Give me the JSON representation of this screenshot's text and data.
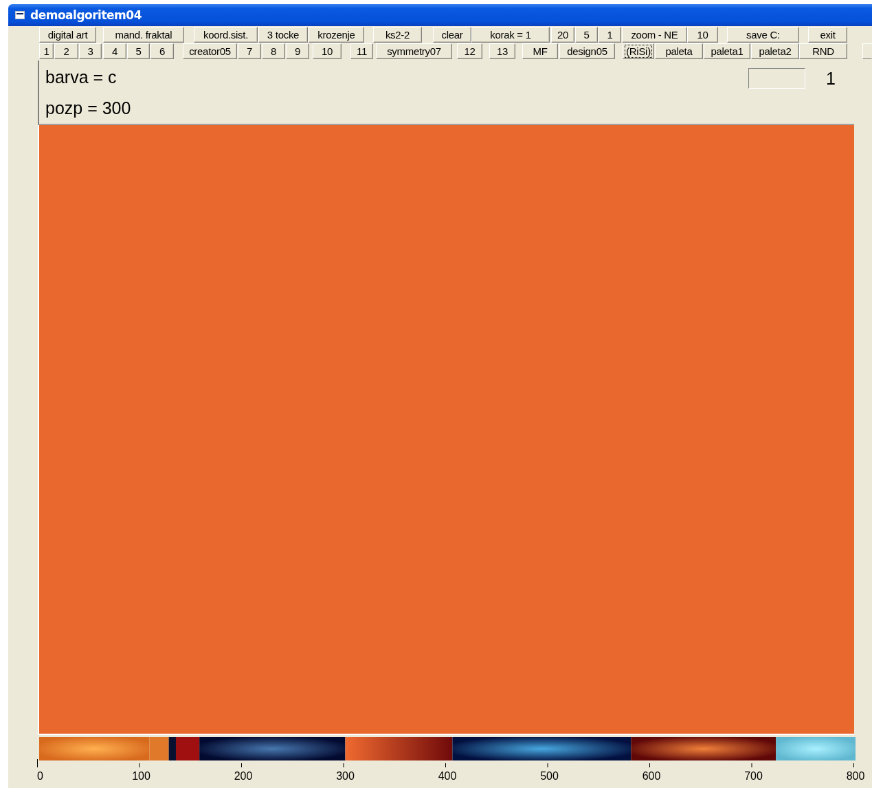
{
  "window": {
    "title": "demoalgoritem04"
  },
  "toolbar_row_1": [
    {
      "label": "digital art",
      "focused": false
    },
    {
      "label": "mand. fraktal",
      "focused": false
    },
    {
      "label": "koord.sist.",
      "focused": false
    },
    {
      "label": "3 tocke",
      "focused": false
    },
    {
      "label": "krozenje",
      "focused": false
    },
    {
      "label": "ks2-2",
      "focused": false
    },
    {
      "label": "clear",
      "focused": false
    },
    {
      "label": "korak = 1",
      "focused": false
    },
    {
      "label": "20",
      "focused": false
    },
    {
      "label": "5",
      "focused": false
    },
    {
      "label": "1",
      "focused": false
    },
    {
      "label": "zoom - NE",
      "focused": false
    },
    {
      "label": "10",
      "focused": false
    },
    {
      "label": "save  C:",
      "focused": false
    },
    {
      "label": "exit",
      "focused": false
    }
  ],
  "toolbar_row_2": [
    {
      "label": "1",
      "focused": false
    },
    {
      "label": "2",
      "focused": false
    },
    {
      "label": "3",
      "focused": false
    },
    {
      "label": "4",
      "focused": false
    },
    {
      "label": "5",
      "focused": false
    },
    {
      "label": "6",
      "focused": false
    },
    {
      "label": "creator05",
      "focused": false
    },
    {
      "label": "7",
      "focused": false
    },
    {
      "label": "8",
      "focused": false
    },
    {
      "label": "9",
      "focused": false
    },
    {
      "label": "10",
      "focused": false
    },
    {
      "label": "11",
      "focused": false
    },
    {
      "label": "symmetry07",
      "focused": false
    },
    {
      "label": "12",
      "focused": false
    },
    {
      "label": "13",
      "focused": false
    },
    {
      "label": "MF",
      "focused": false
    },
    {
      "label": "design05",
      "focused": false
    },
    {
      "label": "(RiSi)",
      "focused": true
    },
    {
      "label": "paleta",
      "focused": false
    },
    {
      "label": "paleta1",
      "focused": false
    },
    {
      "label": "paleta2",
      "focused": false
    },
    {
      "label": "RND",
      "focused": false
    }
  ],
  "info": {
    "barva": "barva = c",
    "pozp": "pozp = 300",
    "counter": "1"
  },
  "palette_axis": {
    "ticks": [
      "0",
      "100",
      "200",
      "300",
      "400",
      "500",
      "600",
      "700",
      "800"
    ]
  }
}
